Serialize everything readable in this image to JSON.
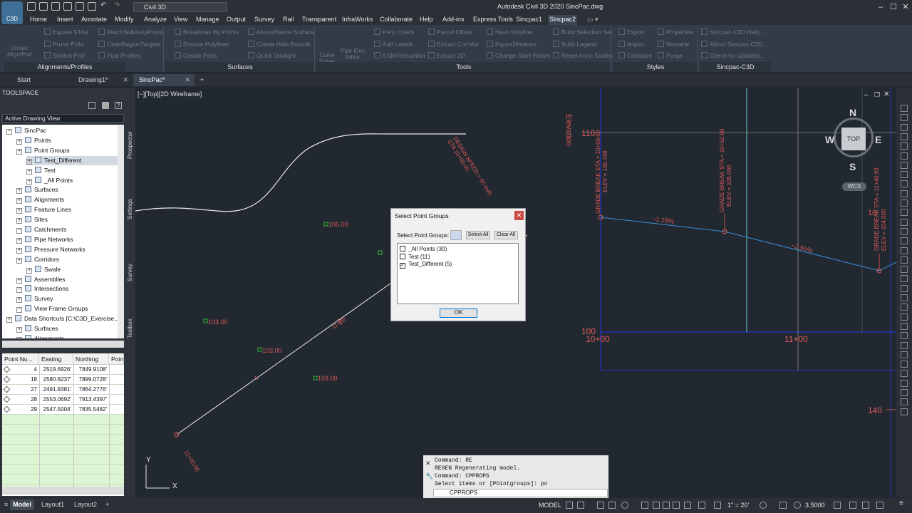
{
  "app": {
    "title": "Autodesk Civil 3D 2020   SincPac.dwg",
    "logo": "C3D",
    "workspace": "Civil 3D"
  },
  "ribbon_tabs": [
    "Home",
    "Insert",
    "Annotate",
    "Modify",
    "Analyze",
    "View",
    "Manage",
    "Output",
    "Survey",
    "Rail",
    "Transparent",
    "InfraWorks",
    "Collaborate",
    "Help",
    "Add-ins",
    "Express Tools",
    "Sincpac1",
    "Sincpac2"
  ],
  "ribbon": {
    "create_align": "Create Align/Prof",
    "col1": [
      "Equate STAs",
      "Prune PVIs",
      "Stretch Prof"
    ],
    "col2": [
      "MatchSubAssyProps",
      "ClearRegionTargets",
      "Pipe Profiles"
    ],
    "col3": [
      "Breaklines By Points",
      "Elevate Polylines",
      "Create Pads"
    ],
    "col4": [
      "Above/Below Surface",
      "Create Hide Bounds",
      "Quick Daylight"
    ],
    "curve_solver": "Curve Solver",
    "pipe_elev_editor": "Pipe Elev Editor",
    "col5": [
      "Perp Check",
      "Add Labels",
      "SSM Renumber"
    ],
    "col6": [
      "Parcel Offset",
      "Extract Corridor",
      "Extract 2D"
    ],
    "col7": [
      "Hash Polyline",
      "Figure2Feature",
      "Change Start Param"
    ],
    "col8": [
      "Build Selection Set",
      "Build Legend",
      "Reset Anno Scales"
    ],
    "col9": [
      "Export",
      "Import",
      "Compare"
    ],
    "col10": [
      "Properties",
      "Rename",
      "Purge"
    ],
    "col11": [
      "Sincpac-C3D Help...",
      "About Sincpac-C3D...",
      "Check for Updates..."
    ],
    "panels": [
      "Alignments/Profiles",
      "Surfaces",
      "Tools",
      "Styles",
      "Sincpac-C3D"
    ]
  },
  "doc_tabs": [
    "Start",
    "Drawing1*",
    "SincPac*"
  ],
  "toolspace": {
    "title": "TOOLSPACE",
    "view": "Active Drawing View",
    "tree": [
      "SincPac",
      "Points",
      "Point Groups",
      "Test_Different",
      "Test",
      "_All Points",
      "Surfaces",
      "Alignments",
      "Feature Lines",
      "Sites",
      "Catchments",
      "Pipe Networks",
      "Pressure Networks",
      "Corridors",
      "Swale",
      "Assemblies",
      "Intersections",
      "Survey",
      "View Frame Groups",
      "Data Shortcuts [C:\\C3D_Exercise...",
      "Surfaces",
      "Alignments"
    ],
    "side_tabs": [
      "Prospector",
      "Settings",
      "Survey",
      "Toolbox"
    ],
    "columns": [
      "Point Nu...",
      "Easting",
      "Northing",
      "Poin"
    ],
    "rows": [
      [
        "4",
        "2519.6926'",
        "7849.9108'"
      ],
      [
        "18",
        "2580.8237'",
        "7899.0728'"
      ],
      [
        "27",
        "2491.9381'",
        "7864.2776'"
      ],
      [
        "28",
        "2553.0692'",
        "7913.4397'"
      ],
      [
        "29",
        "2547.5004'",
        "7835.5482'"
      ]
    ]
  },
  "viewport": {
    "label": "[−][Top][2D Wireframe]"
  },
  "drawing": {
    "spot_labels": [
      "105.00",
      "103.00",
      "103.00",
      "103.00"
    ],
    "station_plan": "11+00",
    "design_speed": [
      "DESIGN SPEED = 60 mi/h",
      "STA 10+00.00"
    ],
    "pt_label": "12+00.00",
    "elevation_title": "Elevation",
    "grade_breaks": [
      [
        "GRADE BREAK STA = 10+00.00",
        "ELEV = 105.748"
      ],
      [
        "GRADE BREAK STA = 10+62.60",
        "ELEV = 105.000"
      ],
      [
        "GRADE BREAK STA = 11+40.93",
        "ELEV = 104.000"
      ]
    ],
    "grades": [
      "−1.19%",
      "−2.55%"
    ],
    "prof_elevs": [
      "110",
      "100",
      "140"
    ],
    "prof_stations": [
      "10+00",
      "11+00"
    ],
    "cutoff_label": "10"
  },
  "viewcube": {
    "N": "N",
    "S": "S",
    "E": "E",
    "W": "W",
    "top": "TOP",
    "wcs": "WCS"
  },
  "dialog": {
    "title": "Select Point Groups",
    "label": "Select Point Groups:",
    "select_all": "Select All",
    "clear_all": "Clear All",
    "items": [
      {
        "label": "_All Points (30)",
        "checked": false
      },
      {
        "label": "Test (11)",
        "checked": false
      },
      {
        "label": "Test_Different (5)",
        "checked": true
      }
    ],
    "ok": "OK"
  },
  "command": {
    "history": [
      "Command: RE",
      "REGEN Regenerating model.",
      "Command: CPPROPS",
      "Select items or [POintgroups]: po"
    ],
    "input": "CPPROPS"
  },
  "layout_tabs": [
    "Model",
    "Layout1",
    "Layout2"
  ],
  "status": {
    "model": "MODEL",
    "scale": "1\" = 20'",
    "value": "3.5000"
  },
  "colors": {
    "drawing_bg": "#212830",
    "red": "#e05a5a",
    "blue": "#3a8fd8",
    "cyan": "#5fd0d0",
    "green": "#35b835"
  }
}
